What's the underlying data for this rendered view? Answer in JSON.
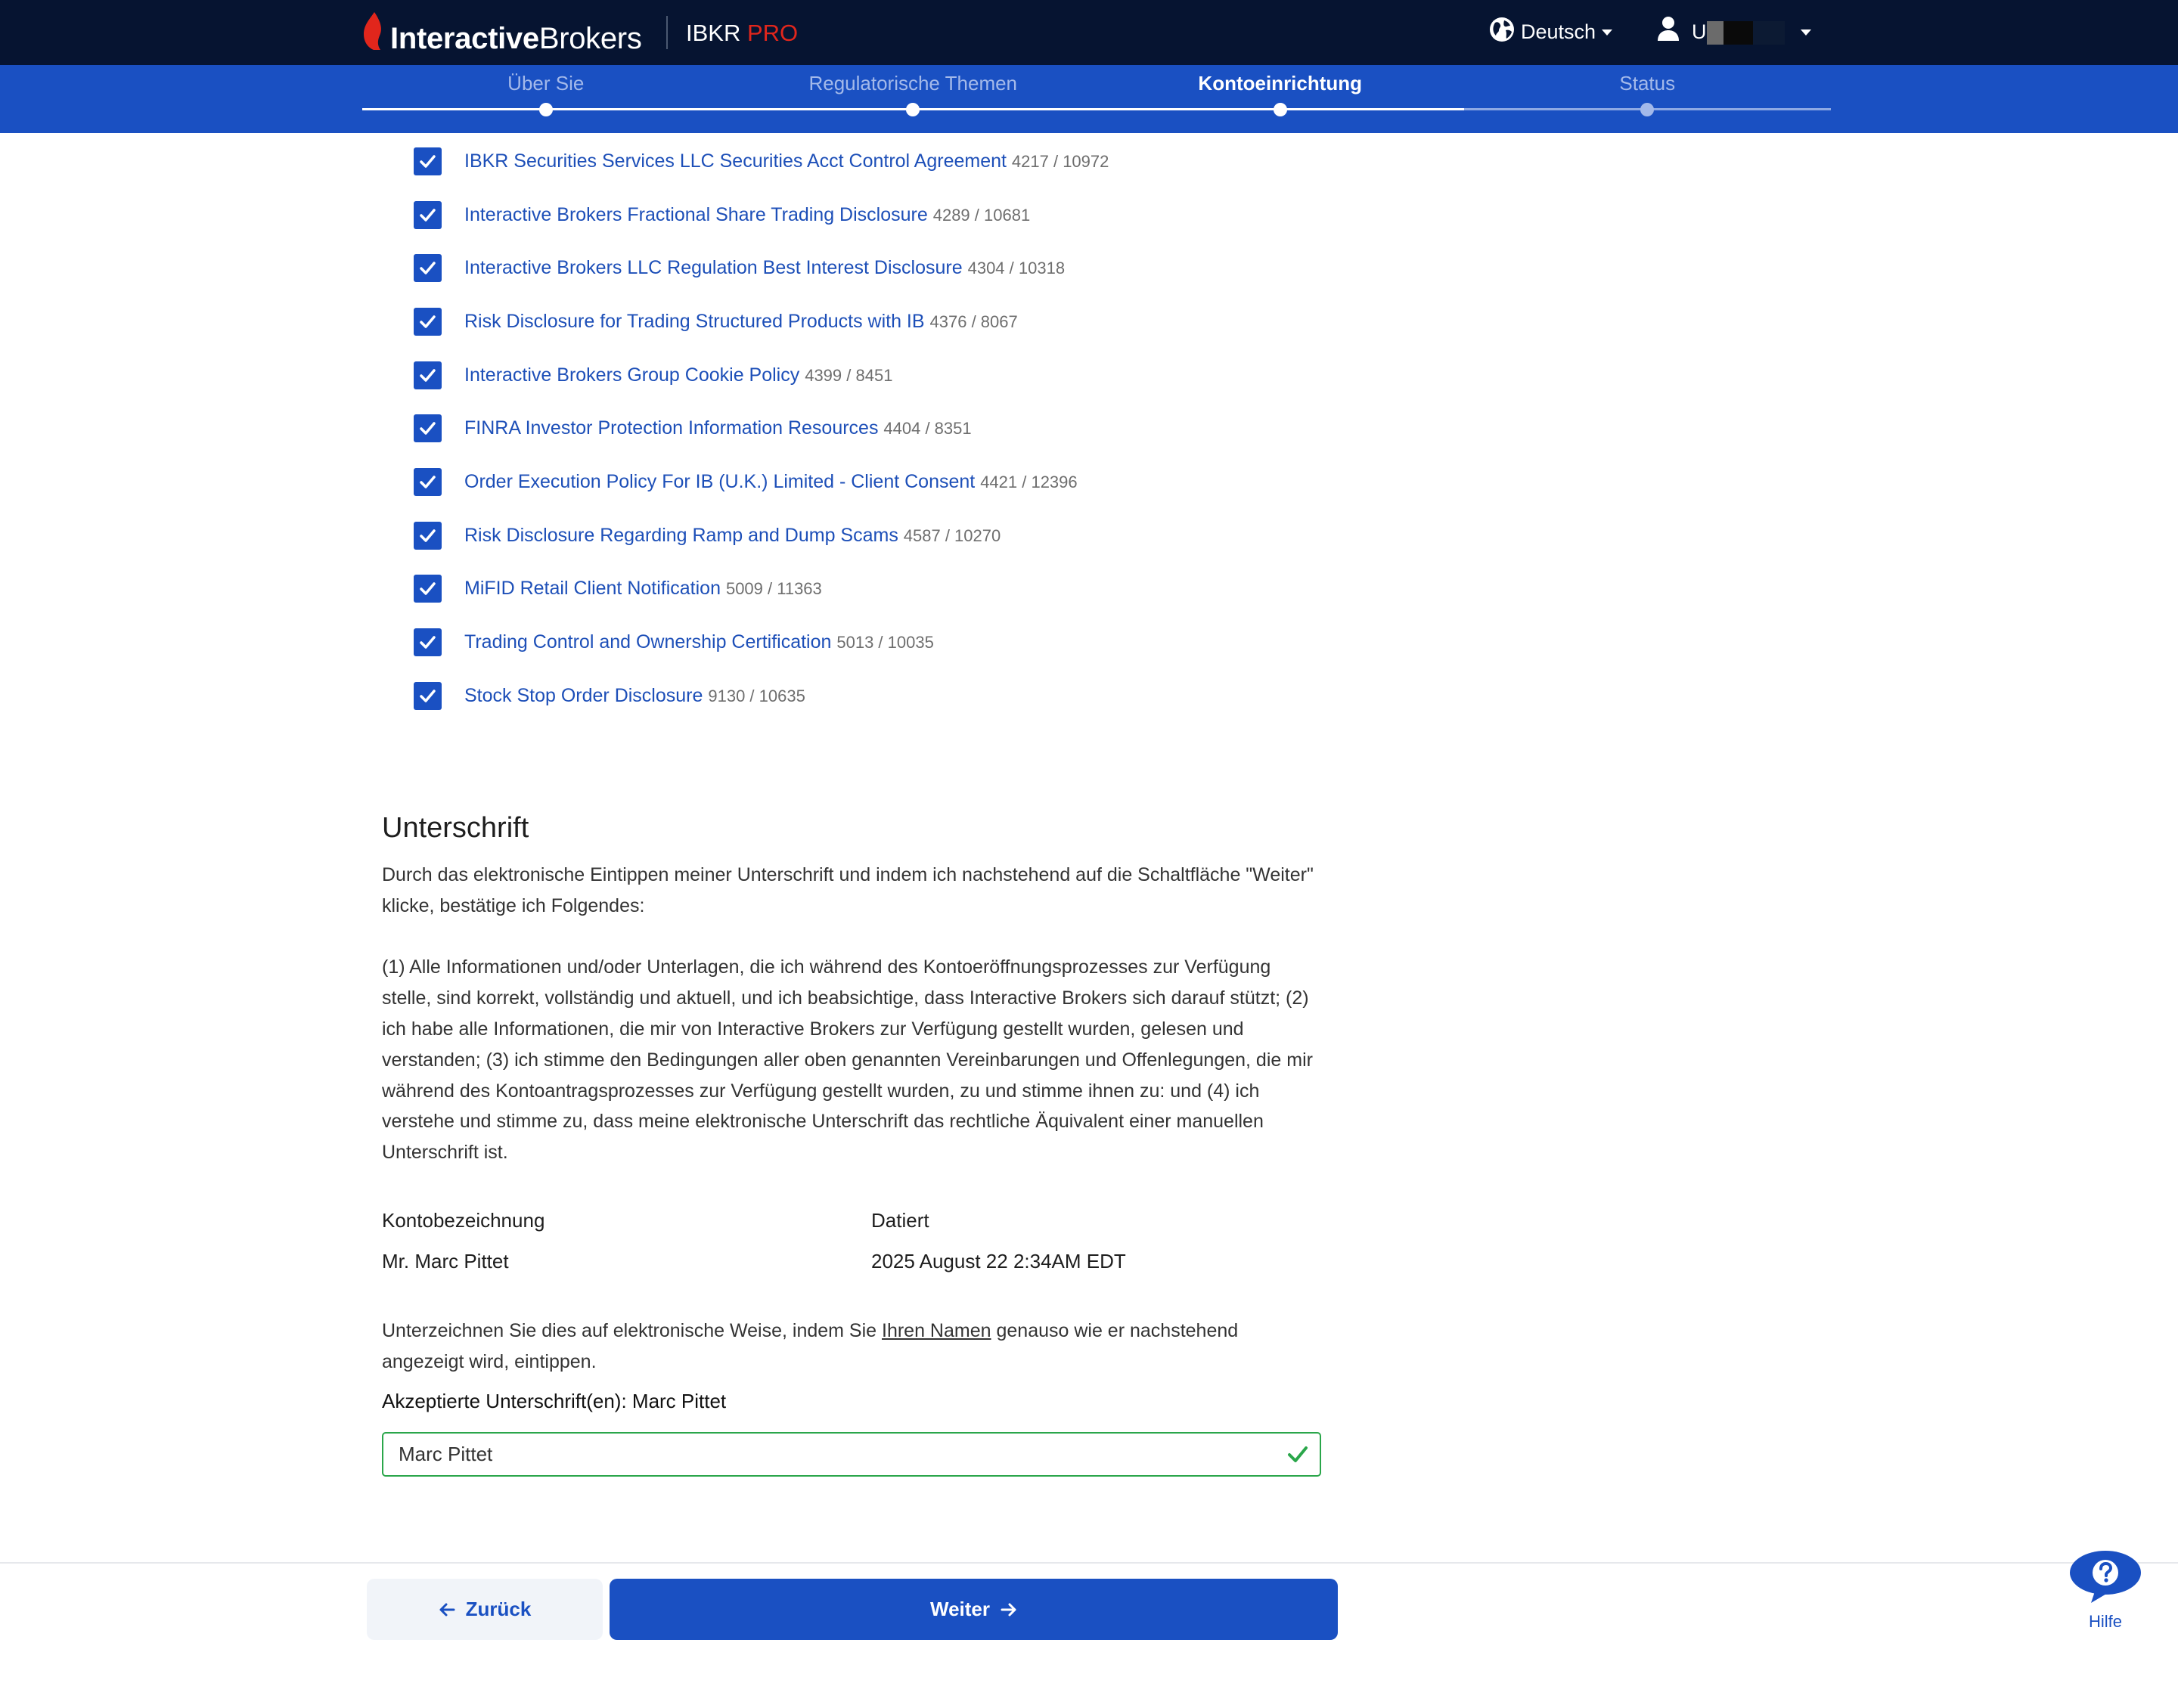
{
  "colors": {
    "accent": "#1a50c2",
    "header_background": "#061431",
    "link": "#1d4fb8",
    "valid": "#2aa64a",
    "brand_red": "#e1261c"
  },
  "header": {
    "logo_bold": "Interactive",
    "logo_regular": "Brokers",
    "product": "IBKR",
    "product_badge": "PRO",
    "language": "Deutsch",
    "language_icon": "globe-icon",
    "user_prefix": "U",
    "user_icon": "user-icon"
  },
  "stepper": {
    "progress": 0.75,
    "steps": [
      {
        "label": "Über Sie",
        "reached": true,
        "active": false
      },
      {
        "label": "Regulatorische Themen",
        "reached": true,
        "active": false
      },
      {
        "label": "Kontoeinrichtung",
        "reached": true,
        "active": true
      },
      {
        "label": "Status",
        "reached": false,
        "active": false
      }
    ]
  },
  "documents": [
    {
      "title": "IBKR Securities Services LLC Securities Acct Control Agreement",
      "ids": "4217 / 10972",
      "checked": true
    },
    {
      "title": "Interactive Brokers Fractional Share Trading Disclosure",
      "ids": "4289 / 10681",
      "checked": true
    },
    {
      "title": "Interactive Brokers LLC Regulation Best Interest Disclosure",
      "ids": "4304 / 10318",
      "checked": true
    },
    {
      "title": "Risk Disclosure for Trading Structured Products with IB",
      "ids": "4376 / 8067",
      "checked": true
    },
    {
      "title": "Interactive Brokers Group Cookie Policy",
      "ids": "4399 / 8451",
      "checked": true
    },
    {
      "title": "FINRA Investor Protection Information Resources",
      "ids": "4404 / 8351",
      "checked": true
    },
    {
      "title": "Order Execution Policy For IB (U.K.) Limited - Client Consent",
      "ids": "4421 / 12396",
      "checked": true
    },
    {
      "title": "Risk Disclosure Regarding Ramp and Dump Scams",
      "ids": "4587 / 10270",
      "checked": true
    },
    {
      "title": "MiFID Retail Client Notification",
      "ids": "5009 / 11363",
      "checked": true
    },
    {
      "title": "Trading Control and Ownership Certification",
      "ids": "5013 / 10035",
      "checked": true
    },
    {
      "title": "Stock Stop Order Disclosure",
      "ids": "9130 / 10635",
      "checked": true
    }
  ],
  "signature": {
    "heading": "Unterschrift",
    "intro": "Durch das elektronische Eintippen meiner Unterschrift und indem ich nachstehend auf die Schaltfläche \"Weiter\" klicke, bestätige ich Folgendes:",
    "terms": "(1) Alle Informationen und/oder Unterlagen, die ich während des Kontoeröffnungsprozesses zur Verfügung stelle, sind korrekt, vollständig und aktuell, und ich beabsichtige, dass Interactive Brokers sich darauf stützt; (2) ich habe alle Informationen, die mir von Interactive Brokers zur Verfügung gestellt wurden, gelesen und verstanden; (3) ich stimme den Bedingungen aller oben genannten Vereinbarungen und Offenlegungen, die mir während des Kontoantragsprozesses zur Verfügung gestellt wurden, zu und stimme ihnen zu: und (4) ich verstehe und stimme zu, dass meine elektronische Unterschrift das rechtliche Äquivalent einer manuellen Unterschrift ist.",
    "account_label": "Kontobezeichnung",
    "account_value": "Mr. Marc Pittet",
    "date_label": "Datiert",
    "date_value": "2025 August 22 2:34AM EDT",
    "instruction_before": "Unterzeichnen Sie dies auf elektronische Weise, indem Sie ",
    "instruction_link": "Ihren Namen",
    "instruction_after": " genauso wie er nachstehend angezeigt wird, eintippen.",
    "accepted_label": "Akzeptierte Unterschrift(en):",
    "accepted_names": "Marc Pittet",
    "input_value": "Marc Pittet",
    "valid_icon": "check-icon"
  },
  "footer": {
    "back_label": "Zurück",
    "back_icon": "arrow-left-icon",
    "next_label": "Weiter",
    "next_icon": "arrow-right-icon"
  },
  "help": {
    "label": "Hilfe",
    "icon": "help-bubble-icon"
  }
}
